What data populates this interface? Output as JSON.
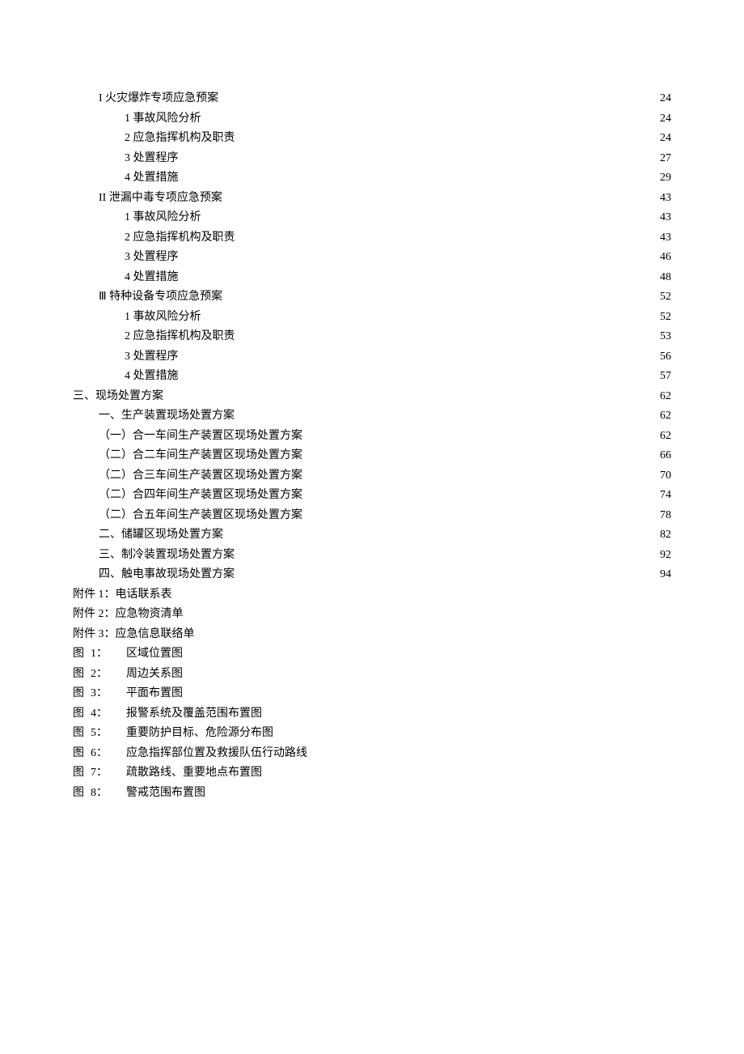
{
  "toc": [
    {
      "indent": 1,
      "label": "I 火灾爆炸专项应急预案 ",
      "page": "24"
    },
    {
      "indent": 2,
      "label": "1 事故风险分析 ",
      "page": "24"
    },
    {
      "indent": 2,
      "label": "2 应急指挥机构及职责 ",
      "page": "24"
    },
    {
      "indent": 2,
      "label": "3 处置程序 ",
      "page": "27"
    },
    {
      "indent": 2,
      "label": "4 处置措施 ",
      "page": "29"
    },
    {
      "indent": 1,
      "label": "II 泄漏中毒专项应急预案 ",
      "page": "43"
    },
    {
      "indent": 2,
      "label": "1 事故风险分析 ",
      "page": "43"
    },
    {
      "indent": 2,
      "label": "2 应急指挥机构及职责 ",
      "page": "43"
    },
    {
      "indent": 2,
      "label": "3 处置程序 ",
      "page": "46"
    },
    {
      "indent": 2,
      "label": "4 处置措施 ",
      "page": "48"
    },
    {
      "indent": 1,
      "label": "Ⅲ 特种设备专项应急预案 ",
      "page": "52"
    },
    {
      "indent": 2,
      "label": "1 事故风险分析 ",
      "page": "52"
    },
    {
      "indent": 2,
      "label": "2 应急指挥机构及职责 ",
      "page": "53"
    },
    {
      "indent": 2,
      "label": "3 处置程序 ",
      "page": "56"
    },
    {
      "indent": 2,
      "label": "4 处置措施 ",
      "page": "57"
    },
    {
      "indent": 0,
      "label": "三、现场处置方案 ",
      "page": "62"
    },
    {
      "indent": 1,
      "label": "一、生产装置现场处置方案 ",
      "page": "62"
    },
    {
      "indent": 3,
      "label": "（一）合一车间生产装置区现场处置方案",
      "page": "62"
    },
    {
      "indent": 3,
      "label": "（二）合二车间生产装置区现场处置方案",
      "page": "66"
    },
    {
      "indent": 3,
      "label": "（二）合三车间生产装置区现场处置方案",
      "page": "70"
    },
    {
      "indent": 3,
      "label": "（二）合四年间生产装置区现场处置方案",
      "page": "74"
    },
    {
      "indent": 3,
      "label": "（二）合五年间生产装置区现场处置方案",
      "page": "78"
    },
    {
      "indent": 1,
      "label": "二、储罐区现场处置方案 ",
      "page": "82"
    },
    {
      "indent": 1,
      "label": "三、制冷装置现场处置方案 ",
      "page": "92"
    },
    {
      "indent": 1,
      "label": "四、触电事故现场处置方案 ",
      "page": "94"
    }
  ],
  "attachments": [
    "附件 1：电话联系表",
    "附件 2：应急物资清单",
    "附件 3：应急信息联络单"
  ],
  "figures": [
    {
      "num": "1：",
      "title": "区域位置图"
    },
    {
      "num": "2：",
      "title": "周边关系图"
    },
    {
      "num": "3：",
      "title": "平面布置图"
    },
    {
      "num": "4：",
      "title": "报警系统及覆盖范围布置图"
    },
    {
      "num": "5：",
      "title": "重要防护目标、危险源分布图"
    },
    {
      "num": "6：",
      "title": "应急指挥部位置及救援队伍行动路线"
    },
    {
      "num": "7：",
      "title": "疏散路线、重要地点布置图"
    },
    {
      "num": "8：",
      "title": "警戒范围布置图"
    }
  ],
  "figureLabel": "图"
}
